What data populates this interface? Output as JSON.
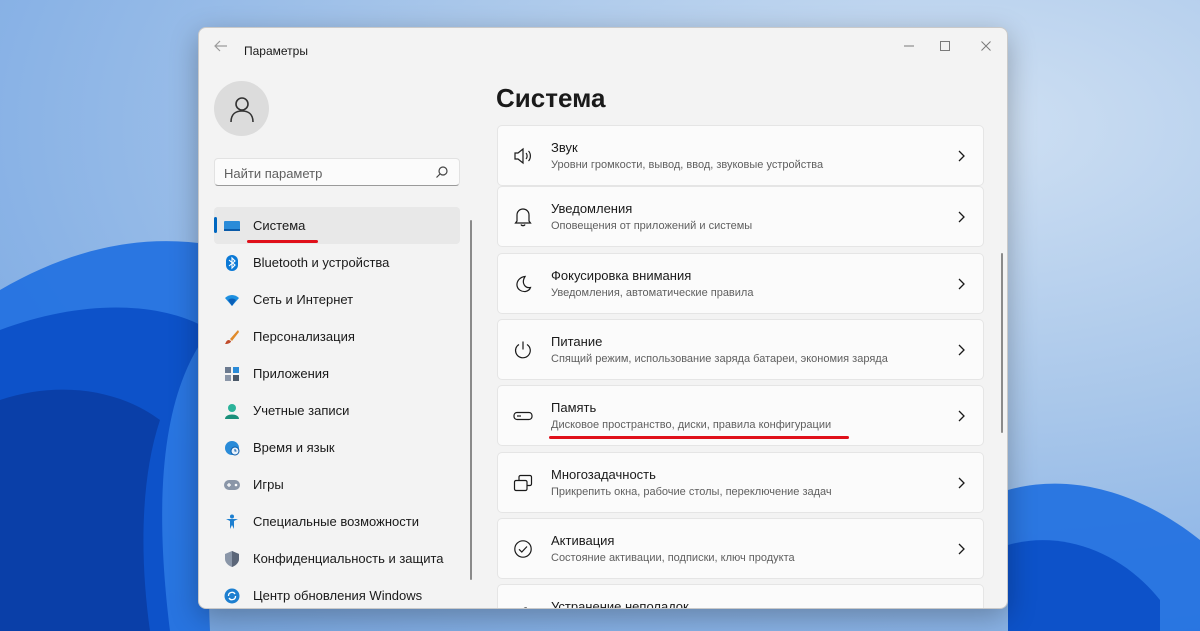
{
  "window": {
    "title": "Параметры"
  },
  "window_controls": {
    "minimize": "—",
    "maximize": "☐",
    "close": "✕"
  },
  "search": {
    "placeholder": "Найти параметр"
  },
  "sidebar": {
    "items": [
      {
        "label": "Система",
        "icon": "monitor-icon",
        "active": true
      },
      {
        "label": "Bluetooth и устройства",
        "icon": "bluetooth-icon"
      },
      {
        "label": "Сеть и Интернет",
        "icon": "wifi-icon"
      },
      {
        "label": "Персонализация",
        "icon": "brush-icon"
      },
      {
        "label": "Приложения",
        "icon": "apps-icon"
      },
      {
        "label": "Учетные записи",
        "icon": "person-icon"
      },
      {
        "label": "Время и язык",
        "icon": "globe-clock-icon"
      },
      {
        "label": "Игры",
        "icon": "gamepad-icon"
      },
      {
        "label": "Специальные возможности",
        "icon": "accessibility-icon"
      },
      {
        "label": "Конфиденциальность и защита",
        "icon": "shield-icon"
      },
      {
        "label": "Центр обновления Windows",
        "icon": "update-icon"
      }
    ]
  },
  "page": {
    "title": "Система"
  },
  "settings": [
    {
      "title": "Звук",
      "subtitle": "Уровни громкости, вывод, ввод, звуковые устройства",
      "icon": "speaker-icon"
    },
    {
      "title": "Уведомления",
      "subtitle": "Оповещения от приложений и системы",
      "icon": "bell-icon"
    },
    {
      "title": "Фокусировка внимания",
      "subtitle": "Уведомления, автоматические правила",
      "icon": "moon-icon"
    },
    {
      "title": "Питание",
      "subtitle": "Спящий режим, использование заряда батареи, экономия заряда",
      "icon": "power-icon"
    },
    {
      "title": "Память",
      "subtitle": "Дисковое пространство, диски, правила конфигурации",
      "icon": "storage-icon"
    },
    {
      "title": "Многозадачность",
      "subtitle": "Прикрепить окна, рабочие столы, переключение задач",
      "icon": "multitask-icon"
    },
    {
      "title": "Активация",
      "subtitle": "Состояние активации, подписки, ключ продукта",
      "icon": "check-circle-icon"
    },
    {
      "title": "Устранение неполадок",
      "subtitle": "",
      "icon": "wrench-icon"
    }
  ],
  "colors": {
    "accent": "#0067c0",
    "highlight": "#e0101a"
  }
}
